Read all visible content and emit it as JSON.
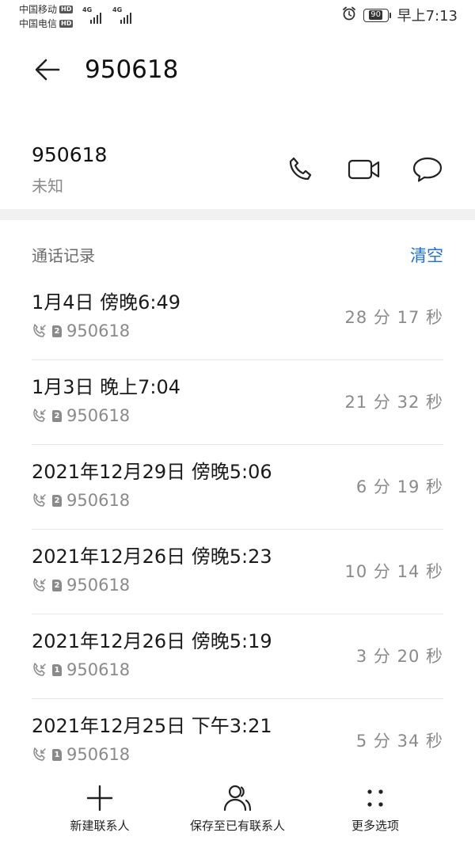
{
  "status_bar": {
    "carrier1": "中国移动",
    "carrier2": "中国电信",
    "hd": "HD",
    "network1": "4G",
    "network2": "4G",
    "battery": "90",
    "time": "早上7:13"
  },
  "header": {
    "title": "950618"
  },
  "contact": {
    "number": "950618",
    "label": "未知"
  },
  "history": {
    "title": "通话记录",
    "clear_label": "清空",
    "calls": [
      {
        "date": "1月4日 傍晚6:49",
        "sim": "2",
        "number": "950618",
        "duration": "28 分 17 秒"
      },
      {
        "date": "1月3日 晚上7:04",
        "sim": "2",
        "number": "950618",
        "duration": "21 分 32 秒"
      },
      {
        "date": "2021年12月29日 傍晚5:06",
        "sim": "2",
        "number": "950618",
        "duration": "6 分 19 秒"
      },
      {
        "date": "2021年12月26日 傍晚5:23",
        "sim": "2",
        "number": "950618",
        "duration": "10 分 14 秒"
      },
      {
        "date": "2021年12月26日 傍晚5:19",
        "sim": "1",
        "number": "950618",
        "duration": "3 分 20 秒"
      },
      {
        "date": "2021年12月25日 下午3:21",
        "sim": "1",
        "number": "950618",
        "duration": "5 分 34 秒"
      }
    ]
  },
  "toolbar": {
    "new_contact": "新建联系人",
    "save_existing": "保存至已有联系人",
    "more": "更多选项"
  },
  "colors": {
    "accent": "#1e6fd9",
    "secondary_text": "#8a8a8a",
    "band": "#f1f1f1"
  },
  "icons": {
    "back": "arrow-left-icon",
    "call": "phone-icon",
    "video": "video-camera-icon",
    "message": "chat-bubble-icon",
    "call_direction": "incoming-call-icon",
    "new_contact": "plus-icon",
    "save_existing": "person-icon",
    "more": "dots-icon",
    "alarm": "alarm-icon"
  }
}
